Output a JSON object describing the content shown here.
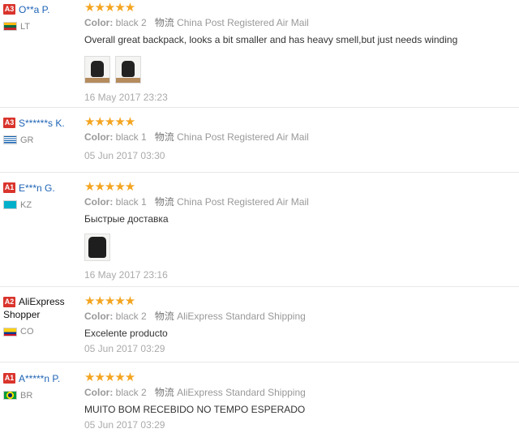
{
  "rating_stars": "★★★★★",
  "color_label": "Color:",
  "shipping_label": "物流",
  "reviews": [
    {
      "level": "A3",
      "name": "O**a P.",
      "country": "LT",
      "flag_colors": [
        "#fdb913",
        "#006a44",
        "#c1272d"
      ],
      "color_value": "black 2",
      "shipping": "China Post Registered Air Mail",
      "text": "Overall great backpack, looks a bit smaller and has heavy smell,but just needs winding",
      "photo_count": 2,
      "date": "16 May 2017 23:23"
    },
    {
      "level": "A3",
      "name": "S******s K.",
      "country": "GR",
      "flag_colors": [
        "#0d5eaf",
        "#ffffff",
        "#0d5eaf"
      ],
      "color_value": "black 1",
      "shipping": "China Post Registered Air Mail",
      "text": "",
      "photo_count": 0,
      "date": "05 Jun 2017 03:30"
    },
    {
      "level": "A1",
      "name": "E***n G.",
      "country": "KZ",
      "flag_colors": [
        "#00afca",
        "#00afca",
        "#00afca"
      ],
      "color_value": "black 1",
      "shipping": "China Post Registered Air Mail",
      "text": "Быстрые доставка",
      "photo_count": 1,
      "date": "16 May 2017 23:16"
    },
    {
      "level": "A2",
      "name": "AliExpress Shopper",
      "country": "CO",
      "flag_colors": [
        "#fcd116",
        "#003893",
        "#ce1126"
      ],
      "color_value": "black 2",
      "shipping": "AliExpress Standard Shipping",
      "text": "Excelente producto",
      "photo_count": 0,
      "date": "05 Jun 2017 03:29"
    },
    {
      "level": "A1",
      "name": "A*****n P.",
      "country": "BR",
      "flag_colors": [
        "#009c3b",
        "#ffdf00",
        "#002776"
      ],
      "color_value": "black 2",
      "shipping": "AliExpress Standard Shipping",
      "text": "MUITO BOM RECEBIDO NO TEMPO ESPERADO",
      "photo_count": 0,
      "date": "05 Jun 2017 03:29"
    }
  ]
}
